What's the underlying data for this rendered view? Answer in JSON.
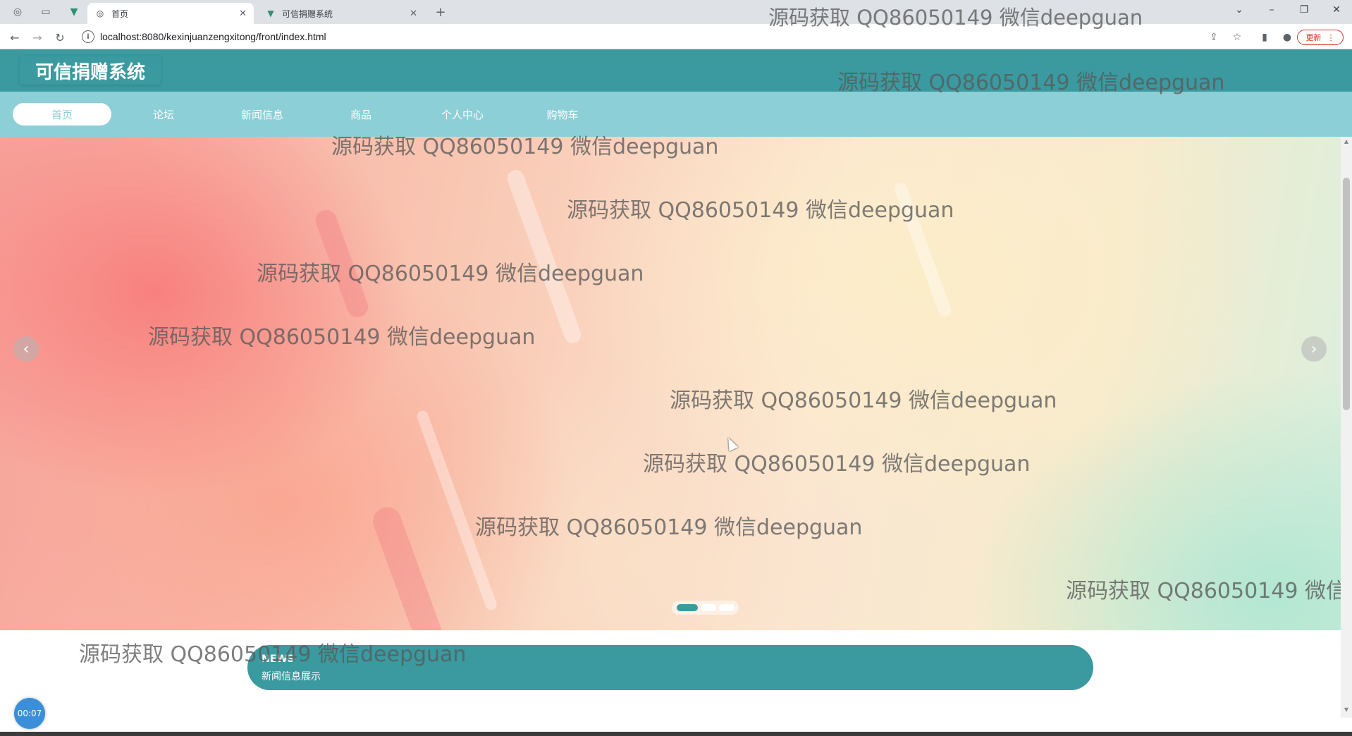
{
  "browser": {
    "tabs": [
      {
        "title": "首页",
        "active": true
      },
      {
        "title": "可信捐赠系统",
        "active": false
      }
    ],
    "new_tab": "+",
    "url": "localhost:8080/kexinjuanzengxitong/front/index.html",
    "update_label": "更新"
  },
  "site": {
    "title": "可信捐赠系统",
    "nav": [
      {
        "label": "首页",
        "active": true
      },
      {
        "label": "论坛",
        "active": false
      },
      {
        "label": "新闻信息",
        "active": false
      },
      {
        "label": "商品",
        "active": false
      },
      {
        "label": "个人中心",
        "active": false
      },
      {
        "label": "购物车",
        "active": false
      }
    ]
  },
  "banner": {
    "prev_glyph": "‹",
    "next_glyph": "›",
    "slide_count": 3,
    "active_slide": 1
  },
  "news": {
    "title_en": "NEWS",
    "title_cn": "新闻信息展示"
  },
  "timer": "00:07",
  "watermark": "源码获取 QQ86050149 微信deepguan",
  "colors": {
    "primary": "#3a9aa0",
    "nav_bg": "#8ccfd6",
    "accent_update": "#d93025"
  }
}
